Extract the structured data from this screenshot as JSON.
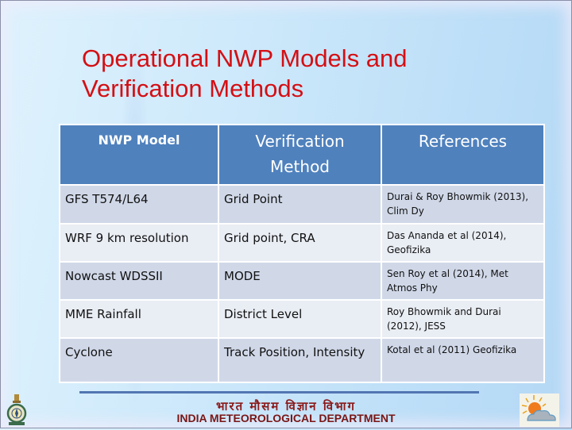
{
  "slide": {
    "title_line1": "Operational NWP Models and",
    "title_line2": "Verification Methods"
  },
  "table": {
    "headers": [
      "NWP Model",
      "Verification Method",
      "References"
    ],
    "rows": [
      [
        "GFS T574/L64",
        "Grid Point",
        "Durai & Roy Bhowmik (2013), Clim Dy"
      ],
      [
        "WRF 9 km resolution",
        "Grid point, CRA",
        "Das Ananda et al (2014), Geofizika"
      ],
      [
        "Nowcast  WDSSII",
        "MODE",
        "Sen Roy  et al (2014), Met Atmos Phy"
      ],
      [
        "MME Rainfall",
        "District Level",
        "Roy Bhowmik and Durai (2012), JESS"
      ],
      [
        "Cyclone",
        "Track Position, Intensity",
        "Kotal et al (2011)  Geofizika"
      ]
    ]
  },
  "footer": {
    "hindi": "भारत मौसम विज्ञान विभाग",
    "english": "INDIA METEOROLOGICAL DEPARTMENT",
    "left_icon": "imd-emblem-icon",
    "right_icon": "sun-cloud-icon"
  },
  "colors": {
    "title": "#d40f14",
    "header_bg": "#4f81bd",
    "row_odd": "#d0d8e8",
    "row_even": "#e9edf4",
    "footer_text": "#8b1a1a",
    "footer_line": "#5276b2"
  }
}
